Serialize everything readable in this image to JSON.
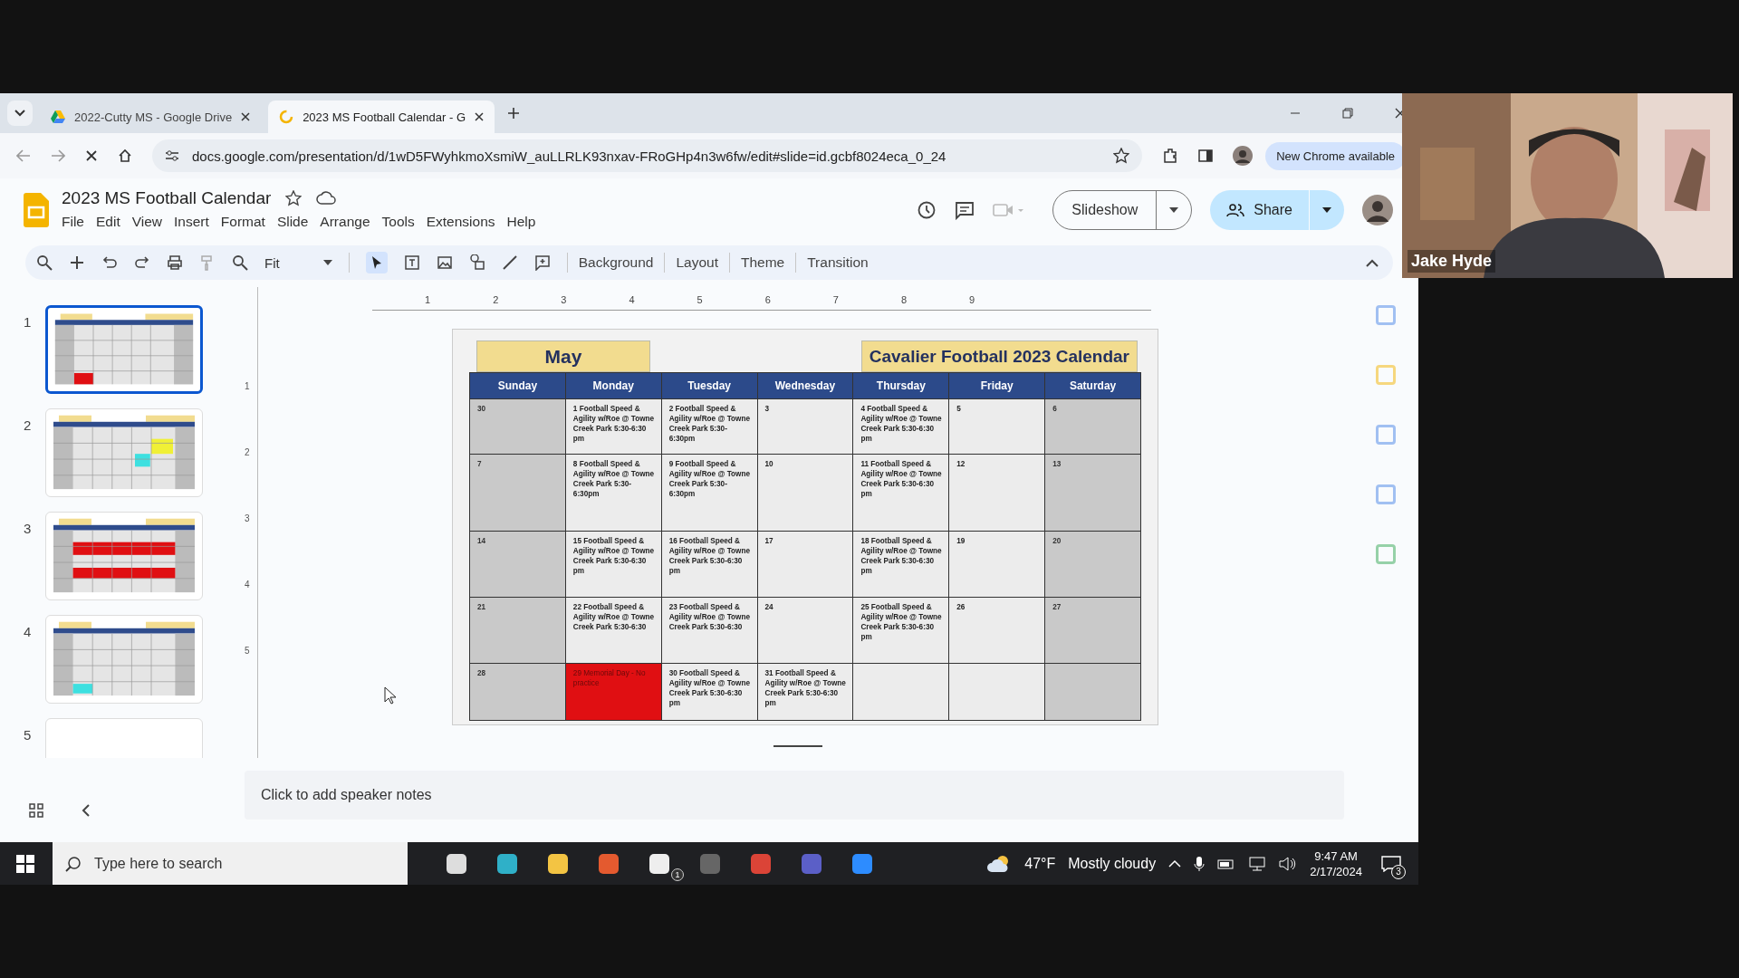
{
  "browser": {
    "tabs": [
      {
        "title": "2022-Cutty MS - Google Drive",
        "kind": "drive",
        "selected": false
      },
      {
        "title": "2023 MS Football Calendar - G",
        "kind": "slides",
        "selected": true
      }
    ],
    "url": "docs.google.com/presentation/d/1wD5FWyhkmoXsmiW_auLLRLK93nxav-FRoGHp4n3w6fw/edit#slide=id.gcbf8024eca_0_24",
    "update_notice": "New Chrome available"
  },
  "document": {
    "title": "2023 MS Football Calendar",
    "menus": [
      "File",
      "Edit",
      "View",
      "Insert",
      "Format",
      "Slide",
      "Arrange",
      "Tools",
      "Extensions",
      "Help"
    ],
    "slideshow_button": "Slideshow",
    "share_button": "Share"
  },
  "toolbar": {
    "zoom": "Fit",
    "buttons": [
      "Background",
      "Layout",
      "Theme",
      "Transition"
    ]
  },
  "ruler": {
    "horizontal": [
      "1",
      "2",
      "3",
      "4",
      "5",
      "6",
      "7",
      "8",
      "9"
    ],
    "vertical": [
      "1",
      "2",
      "3",
      "4",
      "5"
    ]
  },
  "slides": [
    {
      "number": "1",
      "selected": true
    },
    {
      "number": "2",
      "selected": false
    },
    {
      "number": "3",
      "selected": false
    },
    {
      "number": "4",
      "selected": false
    },
    {
      "number": "5",
      "selected": false
    }
  ],
  "calendar": {
    "month": "May",
    "title": "Cavalier Football 2023 Calendar",
    "days": [
      "Sunday",
      "Monday",
      "Tuesday",
      "Wednesday",
      "Thursday",
      "Friday",
      "Saturday"
    ],
    "weeks": [
      [
        {
          "text": "30",
          "kind": "weekend"
        },
        {
          "text": "1  Football Speed & Agility w/Roe @ Towne Creek Park 5:30-6:30 pm",
          "kind": "weekday"
        },
        {
          "text": "2  Football Speed & Agility w/Roe @ Towne Creek Park 5:30-6:30pm",
          "kind": "weekday"
        },
        {
          "text": "3",
          "kind": "weekday"
        },
        {
          "text": "4  Football Speed & Agility w/Roe @ Towne Creek Park 5:30-6:30 pm",
          "kind": "weekday"
        },
        {
          "text": "5",
          "kind": "weekday"
        },
        {
          "text": "6",
          "kind": "weekend"
        }
      ],
      [
        {
          "text": "7",
          "kind": "weekend"
        },
        {
          "text": "8  Football Speed & Agility w/Roe @ Towne Creek Park 5:30-6:30pm",
          "kind": "weekday"
        },
        {
          "text": "9  Football Speed & Agility w/Roe @ Towne Creek Park 5:30-6:30pm",
          "kind": "weekday"
        },
        {
          "text": "10",
          "kind": "weekday"
        },
        {
          "text": "11  Football Speed & Agility w/Roe @ Towne Creek Park 5:30-6:30 pm",
          "kind": "weekday"
        },
        {
          "text": "12",
          "kind": "weekday"
        },
        {
          "text": "13",
          "kind": "weekend"
        }
      ],
      [
        {
          "text": "14",
          "kind": "weekend"
        },
        {
          "text": "15  Football Speed & Agility w/Roe @ Towne Creek Park 5:30-6:30 pm",
          "kind": "weekday"
        },
        {
          "text": "16  Football Speed & Agility w/Roe @ Towne Creek Park 5:30-6:30 pm",
          "kind": "weekday"
        },
        {
          "text": "17",
          "kind": "weekday"
        },
        {
          "text": "18  Football Speed & Agility w/Roe @ Towne Creek Park 5:30-6:30 pm",
          "kind": "weekday"
        },
        {
          "text": "19",
          "kind": "weekday"
        },
        {
          "text": "20",
          "kind": "weekend"
        }
      ],
      [
        {
          "text": "21",
          "kind": "weekend"
        },
        {
          "text": "22  Football Speed & Agility w/Roe @ Towne Creek Park 5:30-6:30",
          "kind": "weekday"
        },
        {
          "text": "23  Football Speed & Agility w/Roe @ Towne Creek Park 5:30-6:30",
          "kind": "weekday"
        },
        {
          "text": "24",
          "kind": "weekday"
        },
        {
          "text": "25  Football Speed & Agility w/Roe @ Towne Creek Park 5:30-6:30 pm",
          "kind": "weekday"
        },
        {
          "text": "26",
          "kind": "weekday"
        },
        {
          "text": "27",
          "kind": "weekend"
        }
      ],
      [
        {
          "text": "28",
          "kind": "weekend"
        },
        {
          "text": "29 Memorial Day - No practice",
          "kind": "holiday"
        },
        {
          "text": "30  Football Speed & Agility w/Roe @ Towne Creek Park 5:30-6:30 pm",
          "kind": "weekday"
        },
        {
          "text": "31  Football Speed & Agility w/Roe @ Towne Creek Park 5:30-6:30 pm",
          "kind": "weekday"
        },
        {
          "kind": "weekday"
        },
        {
          "kind": "weekday"
        },
        {
          "kind": "weekend"
        }
      ]
    ]
  },
  "speaker_notes": {
    "placeholder": "Click to add speaker notes"
  },
  "webcam": {
    "name": "Jake Hyde"
  },
  "taskbar": {
    "search": {
      "placeholder": "Type here to search"
    },
    "temperature": "47°F",
    "weather": "Mostly cloudy",
    "time": "9:47 AM",
    "date": "2/17/2024",
    "mail_badge": "1",
    "notifications": "3"
  }
}
